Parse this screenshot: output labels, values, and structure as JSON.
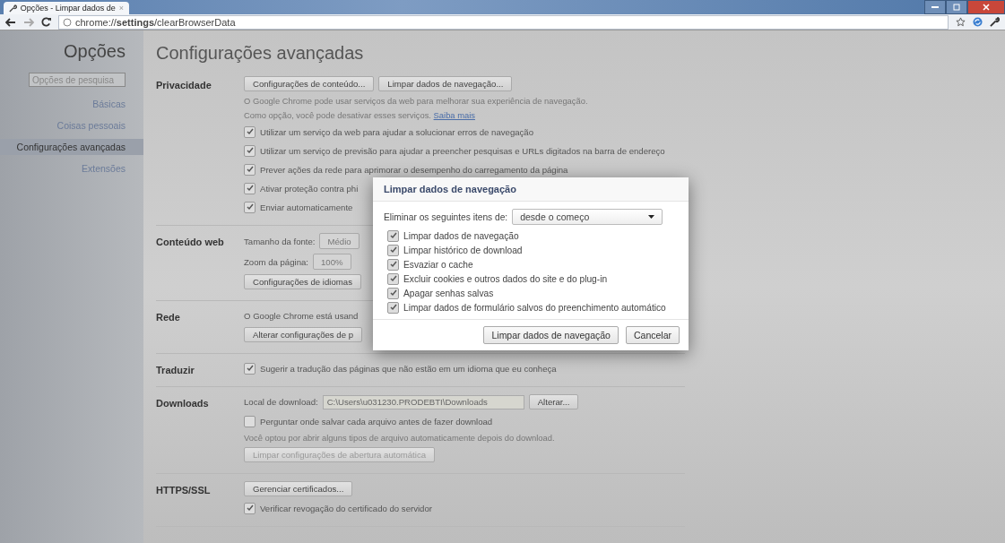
{
  "tab": {
    "title": "Opções - Limpar dados de",
    "close": "×"
  },
  "address": {
    "url": "chrome://**settings**/clearBrowserData"
  },
  "sidebar": {
    "title": "Opções",
    "search": {
      "placeholder": "Opções de pesquisa"
    },
    "items": [
      {
        "label": "Básicas",
        "selected": false
      },
      {
        "label": "Coisas pessoais",
        "selected": false
      },
      {
        "label": "Configurações avançadas",
        "selected": true
      },
      {
        "label": "Extensões",
        "selected": false
      }
    ]
  },
  "page_title": "Configurações avançadas",
  "sections": [
    {
      "label": "Privacidade",
      "rows": [
        {
          "kind": "buttons",
          "buttons": [
            {
              "label": "Configurações de conteúdo...",
              "disabled": false
            },
            {
              "label": "Limpar dados de navegação...",
              "disabled": false
            }
          ]
        },
        {
          "kind": "note",
          "text": "O Google Chrome pode usar serviços da web para melhorar sua experiência de navegação."
        },
        {
          "kind": "note",
          "text": "Como opção, você pode desativar esses serviços.",
          "link": "Saiba mais"
        },
        {
          "kind": "checkbox",
          "label": "Utilizar um serviço da web para ajudar a solucionar erros de navegação",
          "checked": true
        },
        {
          "kind": "checkbox",
          "label": "Utilizar um serviço de previsão para ajudar a preencher pesquisas e URLs digitados na barra de endereço",
          "checked": true
        },
        {
          "kind": "checkbox",
          "label": "Prever ações da rede para aprimorar o desempenho do carregamento da página",
          "checked": true
        },
        {
          "kind": "checkbox",
          "label": "Ativar proteção contra phi",
          "checked": true
        },
        {
          "kind": "checkbox",
          "label": "Enviar automaticamente",
          "checked": true
        }
      ]
    },
    {
      "label": "Conteúdo web",
      "rows": [
        {
          "kind": "select",
          "label": "Tamanho da fonte:",
          "value": "Médio"
        },
        {
          "kind": "select",
          "label": "Zoom da página:",
          "value": "100%"
        },
        {
          "kind": "buttons",
          "buttons": [
            {
              "label": "Configurações de idiomas",
              "disabled": false
            }
          ]
        }
      ]
    },
    {
      "label": "Rede",
      "rows": [
        {
          "kind": "text",
          "text": "O Google Chrome está usand"
        },
        {
          "kind": "buttons",
          "buttons": [
            {
              "label": "Alterar configurações de p",
              "disabled": false
            }
          ]
        }
      ]
    },
    {
      "label": "Traduzir",
      "rows": [
        {
          "kind": "checkbox",
          "label": "Sugerir a tradução das páginas que não estão em um idioma que eu conheça",
          "checked": true
        }
      ]
    },
    {
      "label": "Downloads",
      "rows": [
        {
          "kind": "field",
          "label": "Local de download:",
          "value": "C:\\Users\\u031230.PRODEBTI\\Downloads",
          "button": "Alterar..."
        },
        {
          "kind": "checkbox",
          "label": "Perguntar onde salvar cada arquivo antes de fazer download",
          "checked": false
        },
        {
          "kind": "note",
          "text": "Você optou por abrir alguns tipos de arquivo automaticamente depois do download."
        },
        {
          "kind": "buttons",
          "buttons": [
            {
              "label": "Limpar configurações de abertura automática",
              "disabled": true
            }
          ]
        }
      ]
    },
    {
      "label": "HTTPS/SSL",
      "rows": [
        {
          "kind": "buttons",
          "buttons": [
            {
              "label": "Gerenciar certificados...",
              "disabled": false
            }
          ]
        },
        {
          "kind": "checkbox",
          "label": "Verificar revogação do certificado do servidor",
          "checked": true
        }
      ]
    }
  ],
  "dialog": {
    "title": "Limpar dados de navegação",
    "range_label": "Eliminar os seguintes itens de:",
    "range_value": "desde o começo",
    "items": [
      {
        "label": "Limpar dados de navegação",
        "checked": true
      },
      {
        "label": "Limpar histórico de download",
        "checked": true
      },
      {
        "label": "Esvaziar o cache",
        "checked": true
      },
      {
        "label": "Excluir cookies e outros dados do site e do plug-in",
        "checked": true
      },
      {
        "label": "Apagar senhas salvas",
        "checked": true
      },
      {
        "label": "Limpar dados de formulário salvos do preenchimento automático",
        "checked": true
      }
    ],
    "buttons": [
      "Limpar dados de navegação",
      "Cancelar"
    ]
  }
}
